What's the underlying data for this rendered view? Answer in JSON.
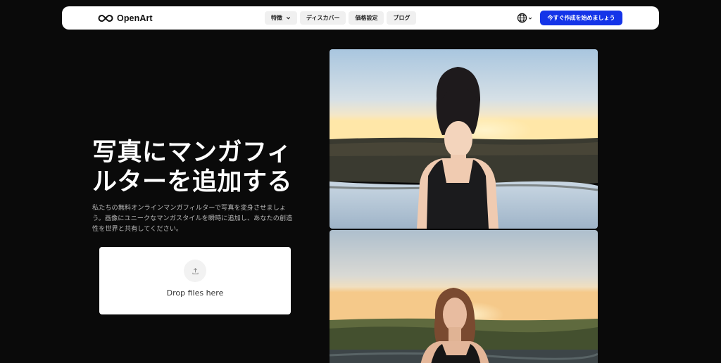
{
  "header": {
    "brand": "OpenArt",
    "nav": [
      {
        "label": "特徴",
        "has_dropdown": true
      },
      {
        "label": "ディスカバー",
        "has_dropdown": false
      },
      {
        "label": "価格設定",
        "has_dropdown": false
      },
      {
        "label": "ブログ",
        "has_dropdown": false
      }
    ],
    "language_icon": "globe-icon",
    "cta_label": "今すぐ作成を始めましょう",
    "cta_color": "#1434e8"
  },
  "hero": {
    "title_line1": "写真にマンガフィ",
    "title_line2": "ルターを追加する",
    "description_line1": "私たちの無料オンラインマンガフィルターで写真を変身させましょ",
    "description_line2": "う。画像にユニークなマンガスタイルを瞬時に追加し、あなたの創造",
    "description_line3": "性を世界と共有してください。",
    "upload_icon": "upload-icon",
    "dropzone_label": "Drop files here"
  },
  "gallery": {
    "items": [
      {
        "name": "manga-filtered-portrait"
      },
      {
        "name": "original-photo-portrait"
      }
    ]
  }
}
